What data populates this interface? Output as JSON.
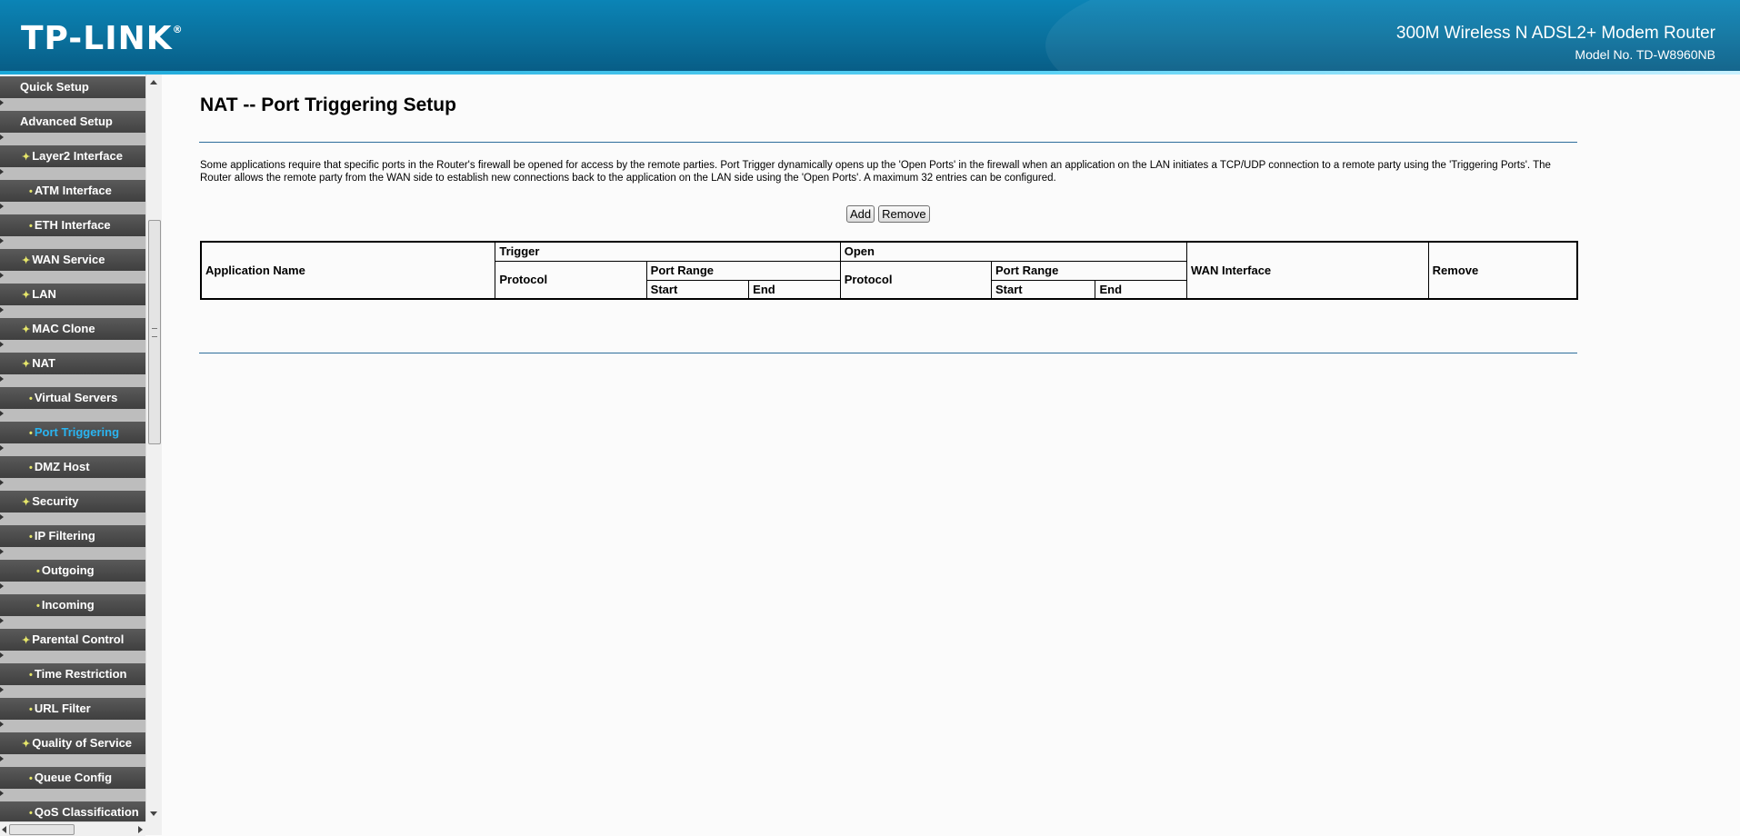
{
  "header": {
    "logo": "TP-LINK",
    "logo_mark": "®",
    "product_title": "300M Wireless N ADSL2+ Modem Router",
    "model_no": "Model No. TD-W8960NB"
  },
  "sidebar": {
    "items": [
      {
        "label": "Quick Setup",
        "level": 0
      },
      {
        "label": "Advanced Setup",
        "level": 0
      },
      {
        "label": "Layer2 Interface",
        "level": 1
      },
      {
        "label": "ATM Interface",
        "level": 2
      },
      {
        "label": "ETH Interface",
        "level": 2
      },
      {
        "label": "WAN Service",
        "level": 1
      },
      {
        "label": "LAN",
        "level": 1
      },
      {
        "label": "MAC Clone",
        "level": 1
      },
      {
        "label": "NAT",
        "level": 1
      },
      {
        "label": "Virtual Servers",
        "level": 2
      },
      {
        "label": "Port Triggering",
        "level": 2,
        "active": true
      },
      {
        "label": "DMZ Host",
        "level": 2
      },
      {
        "label": "Security",
        "level": 1
      },
      {
        "label": "IP Filtering",
        "level": 2
      },
      {
        "label": "Outgoing",
        "level": 3
      },
      {
        "label": "Incoming",
        "level": 3
      },
      {
        "label": "Parental Control",
        "level": 1
      },
      {
        "label": "Time Restriction",
        "level": 2
      },
      {
        "label": "URL Filter",
        "level": 2
      },
      {
        "label": "Quality of Service",
        "level": 1
      },
      {
        "label": "Queue Config",
        "level": 2
      },
      {
        "label": "QoS Classification",
        "level": 2
      }
    ],
    "active_color": "#2ab4f0"
  },
  "main": {
    "title": "NAT -- Port Triggering Setup",
    "description": "Some applications require that specific ports in the Router's firewall be opened for access by the remote parties. Port Trigger dynamically opens up the 'Open Ports' in the firewall when an application on the LAN initiates a TCP/UDP connection to a remote party using the 'Triggering Ports'. The Router allows the remote party from the WAN side to establish new connections back to the application on the LAN side using the 'Open Ports'. A maximum 32 entries can be configured.",
    "add_label": "Add",
    "remove_label": "Remove",
    "table": {
      "application_name": "Application Name",
      "trigger": "Trigger",
      "open": "Open",
      "protocol": "Protocol",
      "port_range": "Port Range",
      "start": "Start",
      "end": "End",
      "wan_interface": "WAN Interface",
      "remove": "Remove"
    }
  }
}
